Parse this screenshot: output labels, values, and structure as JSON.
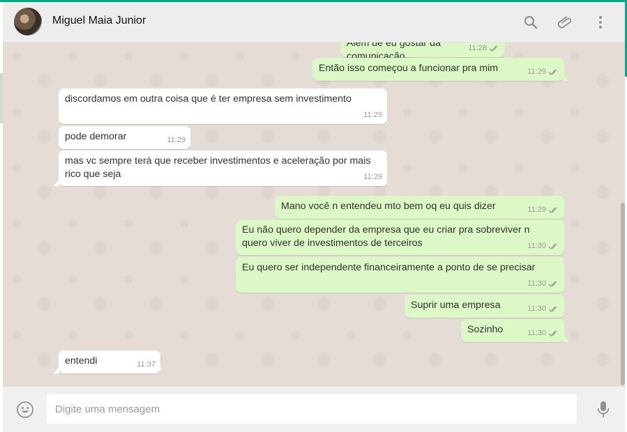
{
  "header": {
    "contact_name": "Miguel Maia Junior",
    "icons": [
      "search-icon",
      "attach-icon",
      "menu-icon"
    ]
  },
  "colors": {
    "accent": "#00a884",
    "outgoing_bubble": "#dcf8c6",
    "incoming_bubble": "#ffffff",
    "chat_background": "#e5ddd5",
    "read_tick": "#999999"
  },
  "messages": [
    {
      "dir": "out",
      "text": "Além de eu gostar da comunicação",
      "time": "11:28",
      "ticks": "double"
    },
    {
      "dir": "out",
      "text": "Então isso começou a funcionar pra mim",
      "time": "11:29",
      "ticks": "double"
    },
    {
      "dir": "in",
      "text": "discordamos em outra coisa que é ter empresa sem investimento",
      "time": "11:29"
    },
    {
      "dir": "in",
      "text": "pode demorar",
      "time": "11:29"
    },
    {
      "dir": "in",
      "text": "mas vc sempre terá que receber investimentos e aceleração por mais rico que seja",
      "time": "11:29"
    },
    {
      "dir": "out",
      "text": "Mano você n entendeu mto bem oq eu quis dizer",
      "time": "11:29",
      "ticks": "double"
    },
    {
      "dir": "out",
      "text": "Eu não quero depender da empresa que eu criar pra sobreviver n quero viver de investimentos de terceiros",
      "time": "11:30",
      "ticks": "double"
    },
    {
      "dir": "out",
      "text": "Eu quero ser independente financeiramente a ponto de se precisar",
      "time": "11:30",
      "ticks": "double"
    },
    {
      "dir": "out",
      "text": "Suprir uma empresa",
      "time": "11:30",
      "ticks": "double"
    },
    {
      "dir": "out",
      "text": "Sozinho",
      "time": "11:30",
      "ticks": "double"
    },
    {
      "dir": "in",
      "text": "entendi",
      "time": "11:37"
    }
  ],
  "composer": {
    "placeholder": "Digite uma mensagem",
    "value": "",
    "left_icon": "emoji-icon",
    "right_icon": "mic-icon"
  }
}
